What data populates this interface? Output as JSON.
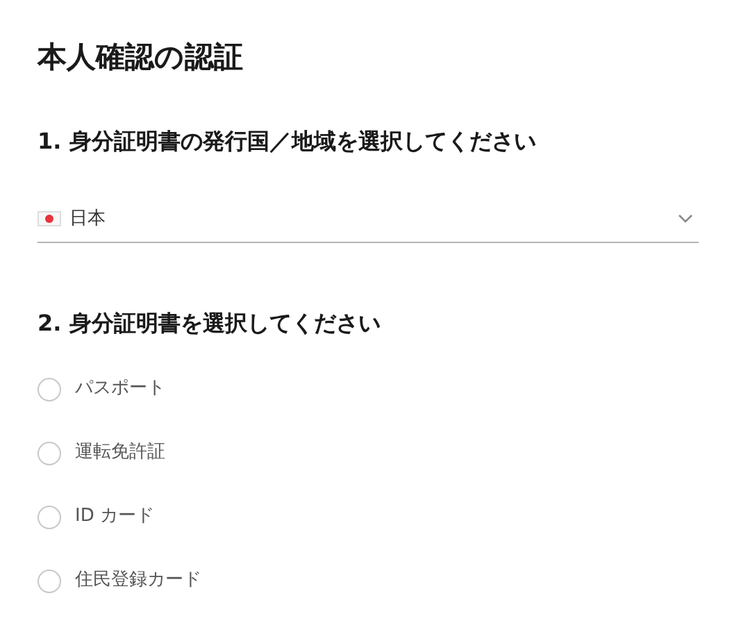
{
  "title": "本人確認の認証",
  "country_section": {
    "heading": "1. 身分証明書の発行国／地域を選択してください",
    "value": "日本"
  },
  "document_section": {
    "heading": "2. 身分証明書を選択してください",
    "options": [
      {
        "label": "パスポート",
        "selected": false
      },
      {
        "label": "運転免許証",
        "selected": false
      },
      {
        "label": "ID カード",
        "selected": false
      },
      {
        "label": "住民登録カード",
        "selected": false
      }
    ]
  }
}
